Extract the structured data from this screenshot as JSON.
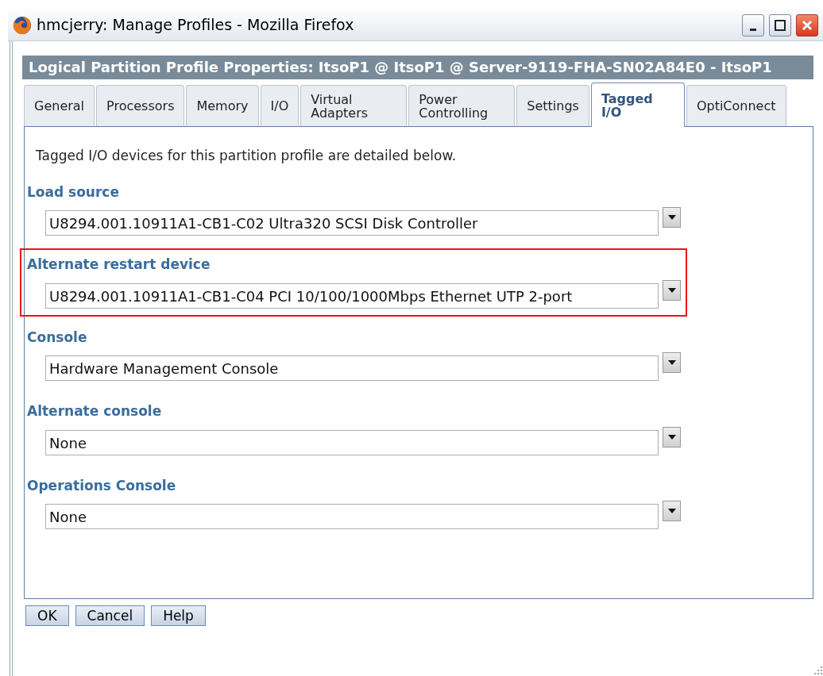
{
  "window": {
    "title": "hmcjerry: Manage Profiles - Mozilla Firefox"
  },
  "header": {
    "title": "Logical Partition Profile Properties: ItsoP1 @ ItsoP1 @ Server-9119-FHA-SN02A84E0 - ItsoP1"
  },
  "tabs": [
    {
      "label": "General",
      "selected": false
    },
    {
      "label": "Processors",
      "selected": false
    },
    {
      "label": "Memory",
      "selected": false
    },
    {
      "label": "I/O",
      "selected": false
    },
    {
      "label": "Virtual Adapters",
      "selected": false
    },
    {
      "label": "Power Controlling",
      "selected": false
    },
    {
      "label": "Settings",
      "selected": false
    },
    {
      "label": "Tagged I/O",
      "selected": true
    },
    {
      "label": "OptiConnect",
      "selected": false
    }
  ],
  "intro": "Tagged I/O devices for this partition profile are detailed below.",
  "fields": [
    {
      "label": "Load source",
      "value": "U8294.001.10911A1-CB1-C02 Ultra320 SCSI Disk Controller",
      "highlighted": false
    },
    {
      "label": "Alternate restart device",
      "value": "U8294.001.10911A1-CB1-C04 PCI 10/100/1000Mbps Ethernet UTP 2-port",
      "highlighted": true
    },
    {
      "label": "Console",
      "value": "Hardware Management Console",
      "highlighted": false
    },
    {
      "label": "Alternate console",
      "value": "None",
      "highlighted": false
    },
    {
      "label": "Operations Console",
      "value": "None",
      "highlighted": false
    }
  ],
  "buttons": [
    "OK",
    "Cancel",
    "Help"
  ]
}
